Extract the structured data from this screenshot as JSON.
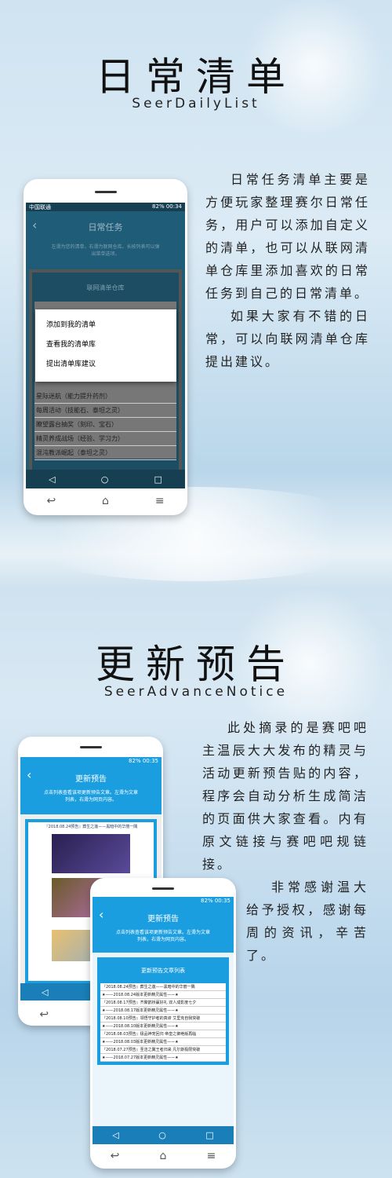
{
  "section1": {
    "title": "日常清单",
    "subtitle": "SeerDailyList",
    "paragraphs": [
      "日常任务清单主要是方便玩家整理赛尔日常任务，用户可以添加自定义的清单，也可以从联网清单仓库里添加喜欢的日常任务到自己的日常清单。",
      "如果大家有不错的日常，可以向联网清单仓库提出建议。"
    ],
    "phone": {
      "status_left": "中国联通",
      "status_right": "82% 00:34",
      "header_title": "日常任务",
      "header_hint": "左滑为您的清单，右滑为联网仓库。长按列表可以弹出菜单选项。",
      "panel_title": "联网清单仓库",
      "menu": [
        "添加到我的清单",
        "查看我的清单库",
        "提出清单库建议"
      ],
      "list": [
        "星际迷航（能力提升药剂）",
        "每周活动（技能石、泰坦之灵）",
        "瞭望露台抽奖（刻印、宝石）",
        "精灵养成战场（经验、学习力）",
        "混沌教派崛起（泰坦之灵）"
      ]
    }
  },
  "section2": {
    "title": "更新预告",
    "subtitle": "SeerAdvanceNotice",
    "paragraphs": [
      "此处摘录的是赛吧吧主温辰大大发布的精灵与活动更新预告贴的内容，程序会自动分析生成简洁的页面供大家查看。内有原文链接与赛吧吧规链接。",
      "非常感谢温大给予授权，感谢每周的资讯，辛苦了。"
    ],
    "phone_back": {
      "status_right": "82% 00:35",
      "header_title": "更新预告",
      "header_hint": "点击列表查看该项更新预告文章。左滑为文章列表，右滑为网页内容。",
      "article_title": "『2018.08.24预告』葬生之莲——黑暗中的华丽一隅"
    },
    "phone_front": {
      "status_right": "82% 00:35",
      "header_title": "更新预告",
      "header_hint": "点击列表查看该项更新预告文章。左滑为文章列表，右滑为网页内容。",
      "panel_title": "更新预告文章列表",
      "list": [
        "『2018.08.24预告』葬生之莲——黑暗中的华丽一隅",
        "★——2018.08.24版本更新精灵属性——★",
        "『2018.08.17预告』齐聚鹊桥赢好礼 双人成影度七夕",
        "★——2018.08.17版本更新精灵属性——★",
        "『2018.08.10预告』领悟守护者的真谛 艾里克自我突破",
        "★——2018.08.10版本更新精灵属性——★",
        "『2018.08.03预告』极品神宠回归 帝皇之御绝版再临",
        "★——2018.08.03版本更新精灵属性——★",
        "『2018.07.27预告』圣洁之翼王者归来 凡尔斯极限突破",
        "★——2018.07.27版本更新精灵属性——★"
      ]
    }
  },
  "colors": {
    "dark_teal": "#1f5c78",
    "blue": "#1a9ee0"
  }
}
